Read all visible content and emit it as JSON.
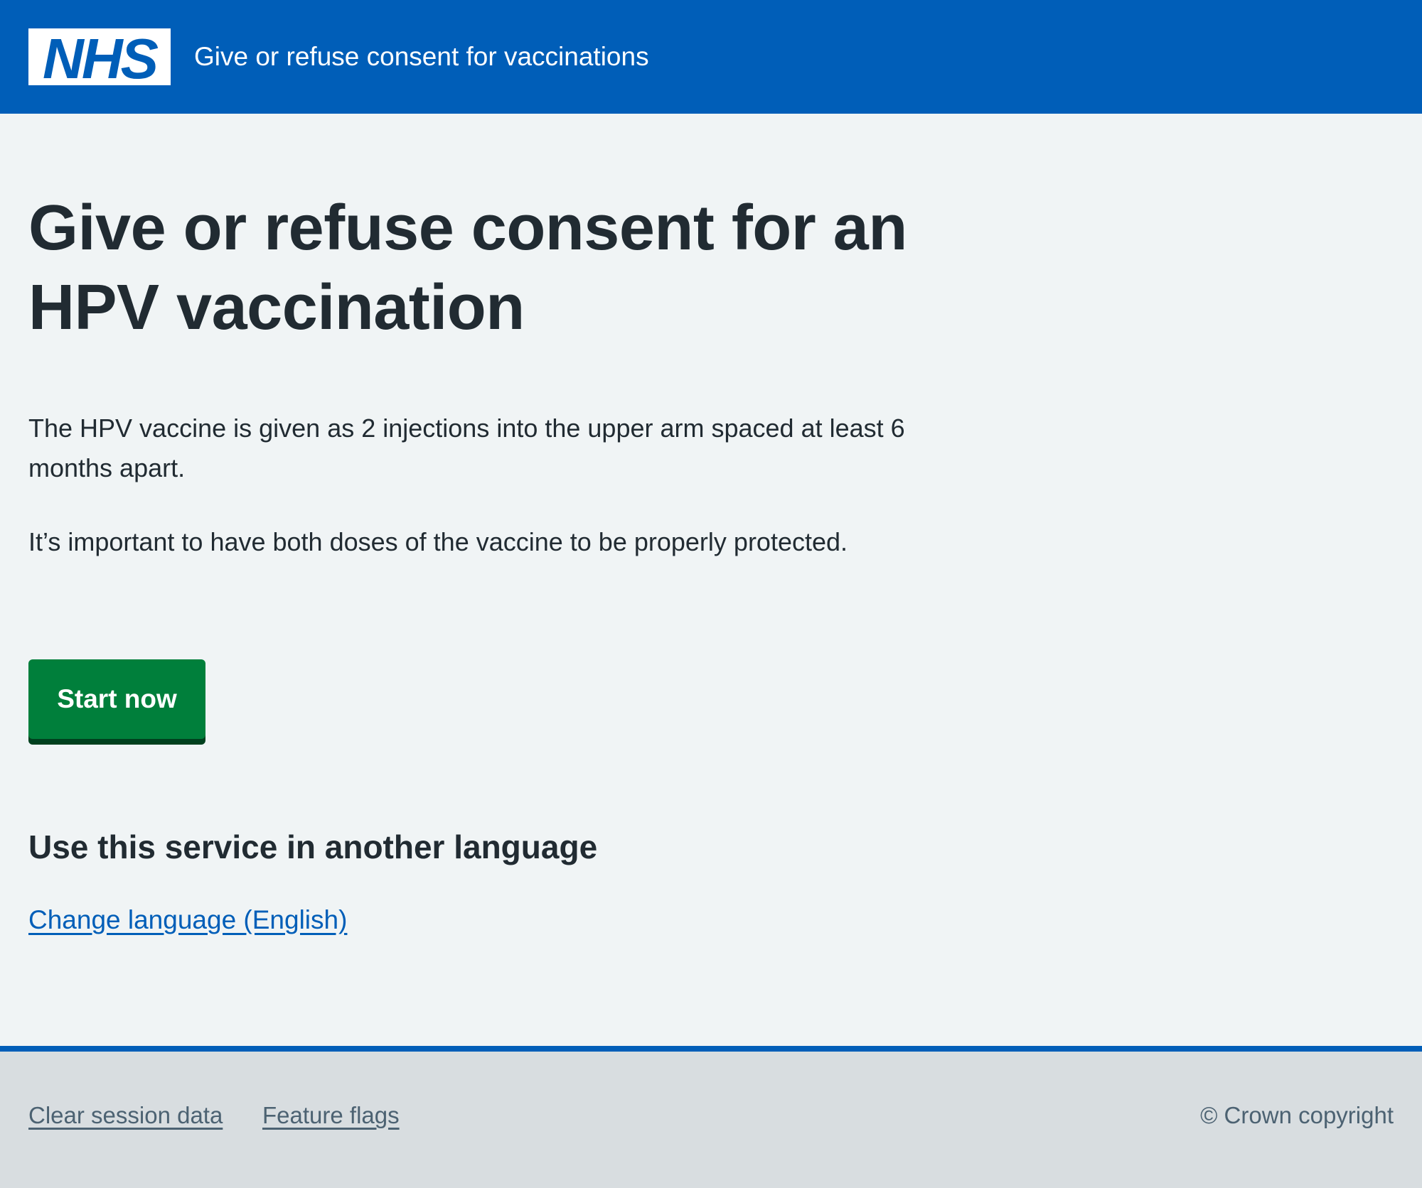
{
  "header": {
    "logo_text": "NHS",
    "service_name": "Give or refuse consent for vaccinations"
  },
  "main": {
    "title": "Give or refuse consent for an HPV vaccination",
    "paragraphs": [
      "The HPV vaccine is given as 2 injections into the upper arm spaced at least 6 months apart.",
      "It’s important to have both doses of the vaccine to be properly protected."
    ],
    "start_button_label": "Start now",
    "language_heading": "Use this service in another language",
    "change_language_link": "Change language (English)"
  },
  "footer": {
    "links": [
      "Clear session data",
      "Feature flags"
    ],
    "copyright": "© Crown copyright"
  },
  "colors": {
    "header_blue": "#005eb8",
    "background": "#f0f4f5",
    "button_green": "#007f3b",
    "footer_grey": "#d8dde0",
    "text": "#212b32",
    "link": "#005eb8"
  }
}
